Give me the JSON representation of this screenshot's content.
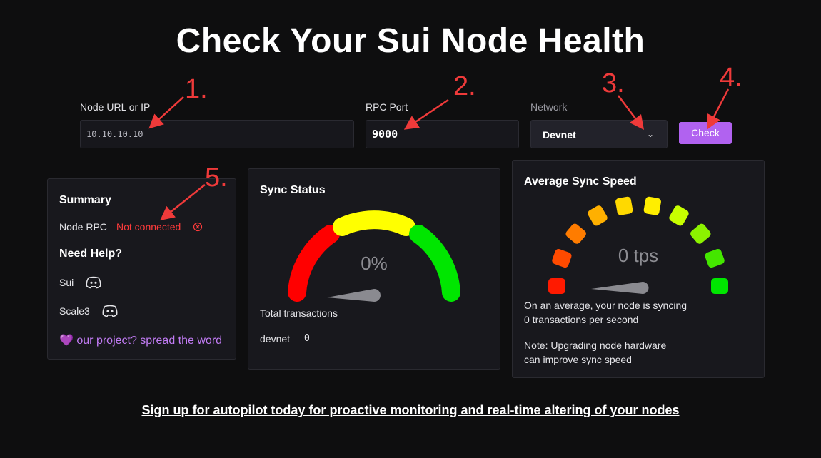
{
  "page_title": "Check Your Sui Node Health",
  "form": {
    "url_label": "Node URL or IP",
    "url_value": "10.10.10.10",
    "port_label": "RPC Port",
    "port_value": "9000",
    "network_label": "Network",
    "network_value": "Devnet",
    "check_label": "Check"
  },
  "summary": {
    "title": "Summary",
    "rpc_label": "Node RPC",
    "rpc_status": "Not connected",
    "help_title": "Need Help?",
    "sui_label": "Sui",
    "scale3_label": "Scale3",
    "spread_link": "💜 our project? spread the word"
  },
  "sync_status": {
    "title": "Sync Status",
    "percent_text": "0%",
    "percent_value": 0,
    "total_label": "Total transactions",
    "network_name": "devnet",
    "tx_count": "0"
  },
  "avg_speed": {
    "title": "Average Sync Speed",
    "tps_text": "0 tps",
    "tps_value": 0,
    "desc_line1": "On an average, your node is syncing",
    "desc_line2": "0 transactions per second",
    "note_line1": "Note: Upgrading node hardware",
    "note_line2": "can improve sync speed"
  },
  "footer_link": "Sign up for autopilot today for proactive monitoring and real-time altering of your nodes",
  "annotations": [
    "1.",
    "2.",
    "3.",
    "4.",
    "5."
  ],
  "colors": {
    "accent": "#b162f0",
    "error": "#ff3b3b",
    "annotation": "#ef3a3a",
    "gauge_red": "#ff0000",
    "gauge_yellow": "#ffff00",
    "gauge_green": "#00e600"
  }
}
